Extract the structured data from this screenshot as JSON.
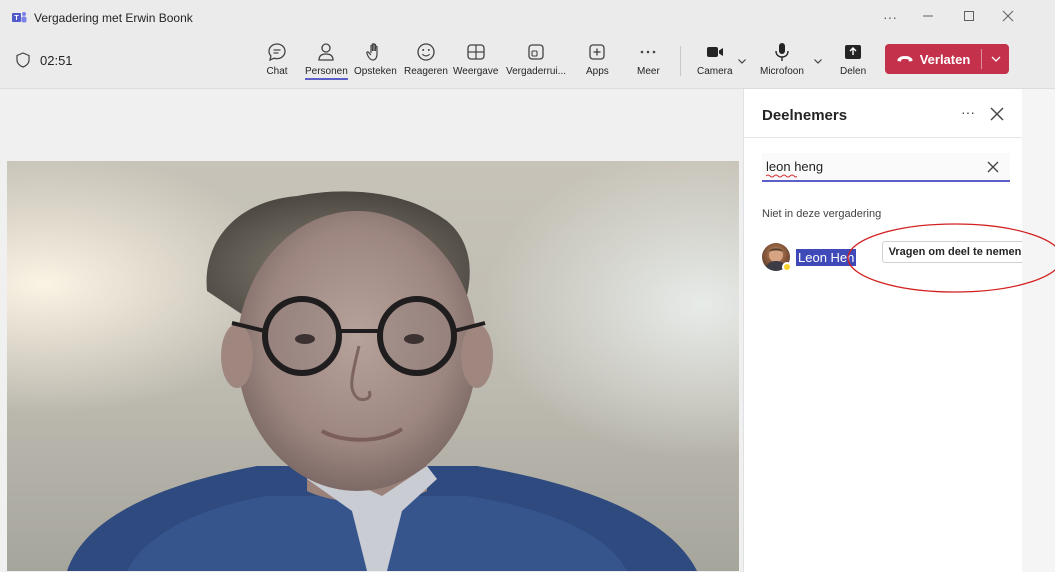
{
  "window": {
    "title": "Vergadering met Erwin Boonk"
  },
  "toolbar": {
    "timer": "02:51",
    "items": [
      {
        "label": "Chat",
        "icon": "chat-icon"
      },
      {
        "label": "Personen",
        "icon": "people-icon"
      },
      {
        "label": "Opsteken",
        "icon": "raise-hand-icon"
      },
      {
        "label": "Reageren",
        "icon": "react-icon"
      },
      {
        "label": "Weergave",
        "icon": "view-icon"
      },
      {
        "label": "Vergaderrui...",
        "icon": "rooms-icon"
      },
      {
        "label": "Apps",
        "icon": "add-apps-icon"
      },
      {
        "label": "Meer",
        "icon": "more-icon"
      }
    ],
    "camera_label": "Camera",
    "mic_label": "Microfoon",
    "share_label": "Delen",
    "leave_label": "Verlaten"
  },
  "panel": {
    "title": "Deelnemers",
    "search_value": "leon heng",
    "section_label": "Niet in deze vergadering",
    "person_name": "Leon Heng",
    "person_name_visible": "Leon Hen",
    "ask_button": "Vragen om deel te nemen"
  },
  "colors": {
    "accent": "#5b5fc7",
    "leave": "#c4314b",
    "highlight": "#3f4ab8",
    "annotation": "#d32020"
  }
}
